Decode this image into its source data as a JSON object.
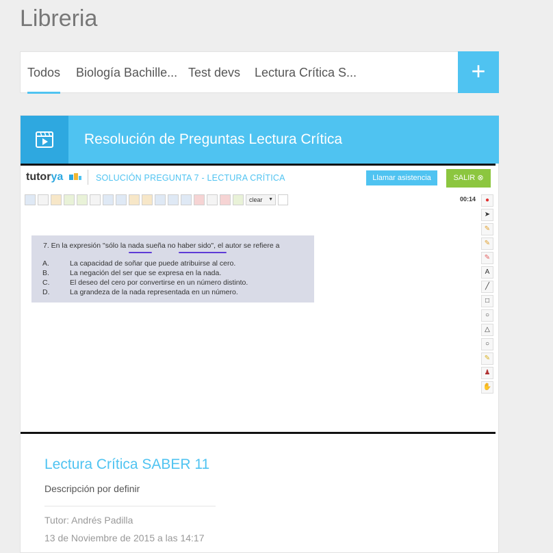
{
  "page": {
    "title": "Libreria"
  },
  "tabs": [
    {
      "label": "Todos",
      "active": true
    },
    {
      "label": "Biología Bachille..."
    },
    {
      "label": "Test devs"
    },
    {
      "label": "Lectura Crítica S..."
    }
  ],
  "add_button": {
    "label": "+"
  },
  "card": {
    "header_title": "Resolución de Preguntas Lectura Crítica",
    "video": {
      "logo": {
        "brand_a": "tutor",
        "brand_b": "ya"
      },
      "title": "SOLUCIÓN PREGUNTA 7 - LECTURA CRÍTICA",
      "help_button": "Llamar asistencia",
      "exit_button": "SALIR",
      "timer": "00:14",
      "toolbar_select": "clear",
      "question": {
        "text": "7. En la expresión \"sólo la nada sueña no haber sido\", el autor se refiere a",
        "options": [
          {
            "letter": "A.",
            "text": "La capacidad de soñar que puede atribuirse al cero."
          },
          {
            "letter": "B.",
            "text": "La negación del ser que se expresa en la nada."
          },
          {
            "letter": "C.",
            "text": "El deseo del cero por convertirse en un número distinto."
          },
          {
            "letter": "D.",
            "text": "La grandeza de la nada representada en un número."
          }
        ]
      }
    },
    "course_title": "Lectura Crítica SABER 11",
    "description": "Descripción por definir",
    "tutor": "Tutor: Andrés Padilla",
    "date": "13 de Noviembre de 2015 a las 14:17"
  },
  "colors": {
    "accent": "#4fc3f1",
    "accent_dark": "#2ea8e0",
    "exit": "#8cc63f"
  }
}
